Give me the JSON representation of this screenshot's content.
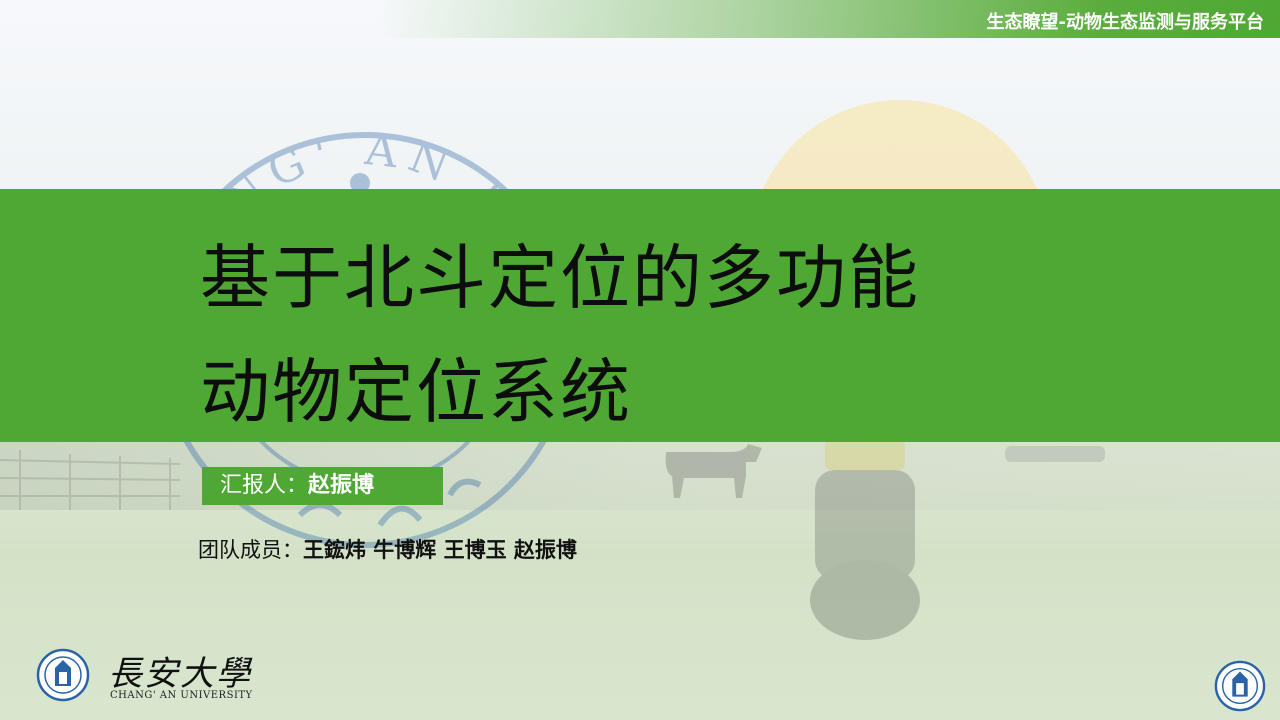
{
  "header": {
    "platform_title": "生态瞭望-动物生态监测与服务平台"
  },
  "slide": {
    "title_line1": "基于北斗定位的多功能",
    "title_line2": "动物定位系统",
    "reporter_label": "汇报人：",
    "reporter_name": "赵振博",
    "team_label": "团队成员：",
    "team_members": "王鋐炜 牛博辉 王博玉 赵振博"
  },
  "logo": {
    "seal_ring_text": "CHANG' AN UNIVERSITY",
    "name_cn": "長安大學",
    "name_en": "CHANG' AN UNIVERSITY"
  },
  "colors": {
    "accent_green": "#4fa834",
    "title_text": "#0d0d0d",
    "seal_blue": "#2a63a8"
  }
}
